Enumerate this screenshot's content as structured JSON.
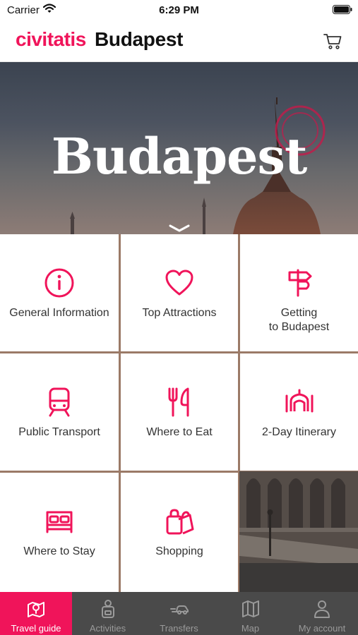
{
  "status_bar": {
    "carrier": "Carrier",
    "time": "6:29 PM"
  },
  "header": {
    "brand": "civitatis",
    "title": "Budapest",
    "cart_icon": "cart-icon"
  },
  "hero": {
    "title": "Budapest"
  },
  "menu": {
    "items": [
      {
        "label": "General Information",
        "icon": "info-icon"
      },
      {
        "label": "Top Attractions",
        "icon": "heart-icon"
      },
      {
        "label": "Getting\nto Budapest",
        "icon": "signpost-icon"
      },
      {
        "label": "Public Transport",
        "icon": "train-icon"
      },
      {
        "label": "Where to Eat",
        "icon": "cutlery-icon"
      },
      {
        "label": "2-Day Itinerary",
        "icon": "monument-icon"
      },
      {
        "label": "Where to Stay",
        "icon": "bed-icon"
      },
      {
        "label": "Shopping",
        "icon": "shopping-bags-icon"
      }
    ]
  },
  "bottom_nav": {
    "items": [
      {
        "label": "Travel guide",
        "icon": "map-pin-icon",
        "active": true
      },
      {
        "label": "Activities",
        "icon": "backpack-icon",
        "active": false
      },
      {
        "label": "Transfers",
        "icon": "transfers-icon",
        "active": false
      },
      {
        "label": "Map",
        "icon": "map-icon",
        "active": false
      },
      {
        "label": "My account",
        "icon": "user-icon",
        "active": false
      }
    ]
  },
  "colors": {
    "brand": "#f0145a",
    "nav_bg": "#4a4a4a",
    "nav_inactive": "#9a9a9a"
  }
}
